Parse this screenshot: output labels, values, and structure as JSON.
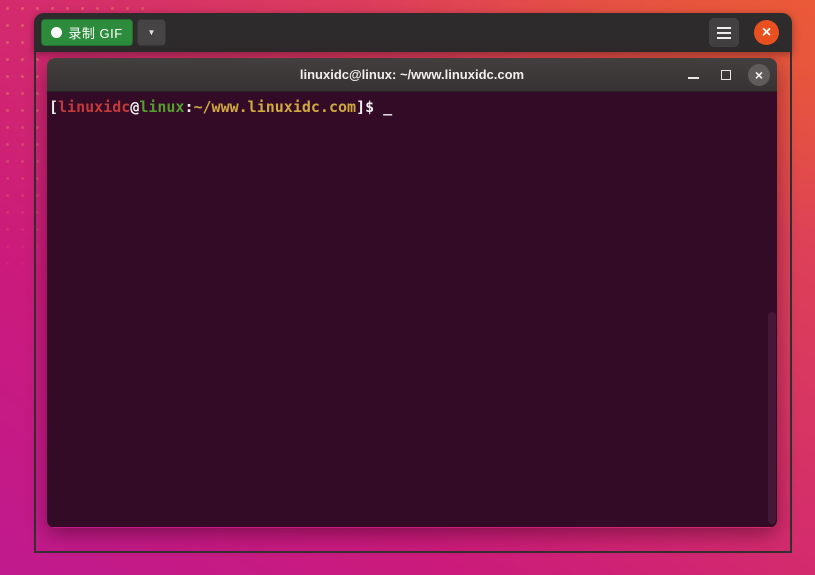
{
  "peek_recorder": {
    "toolbar": {
      "record_button_label": "录制 GIF",
      "icons": {
        "record_dot": "●",
        "dropdown_arrow": "▼",
        "menu": "hamburger-three-bars",
        "close": "×"
      }
    },
    "accent_colors": {
      "record_green": "#2d8c3b",
      "close_orange": "#e8501f",
      "header_bg": "#2e2b2c"
    }
  },
  "terminal": {
    "titlebar": {
      "title": "linuxidc@linux: ~/www.linuxidc.com",
      "icons": {
        "minimize": "–",
        "maximize": "□",
        "close": "×"
      }
    },
    "prompt": {
      "open_bracket": "[",
      "user": "linuxidc",
      "at": "@",
      "host": "linux",
      "colon": ":",
      "path": "~/www.linuxidc.com",
      "close_bracket": "]",
      "dollar": "$",
      "space": " ",
      "cursor": "_"
    },
    "colors": {
      "background": "#330b27",
      "plain_text": "#eeeeec",
      "user_red": "#c23a3a",
      "host_green": "#539e2f",
      "path_yellow": "#cfa93f"
    }
  },
  "desktop": {
    "wallpaper_colors": {
      "top_right": "#e4543e",
      "middle": "#d42c6c",
      "bottom_left": "#c01a8e"
    }
  }
}
